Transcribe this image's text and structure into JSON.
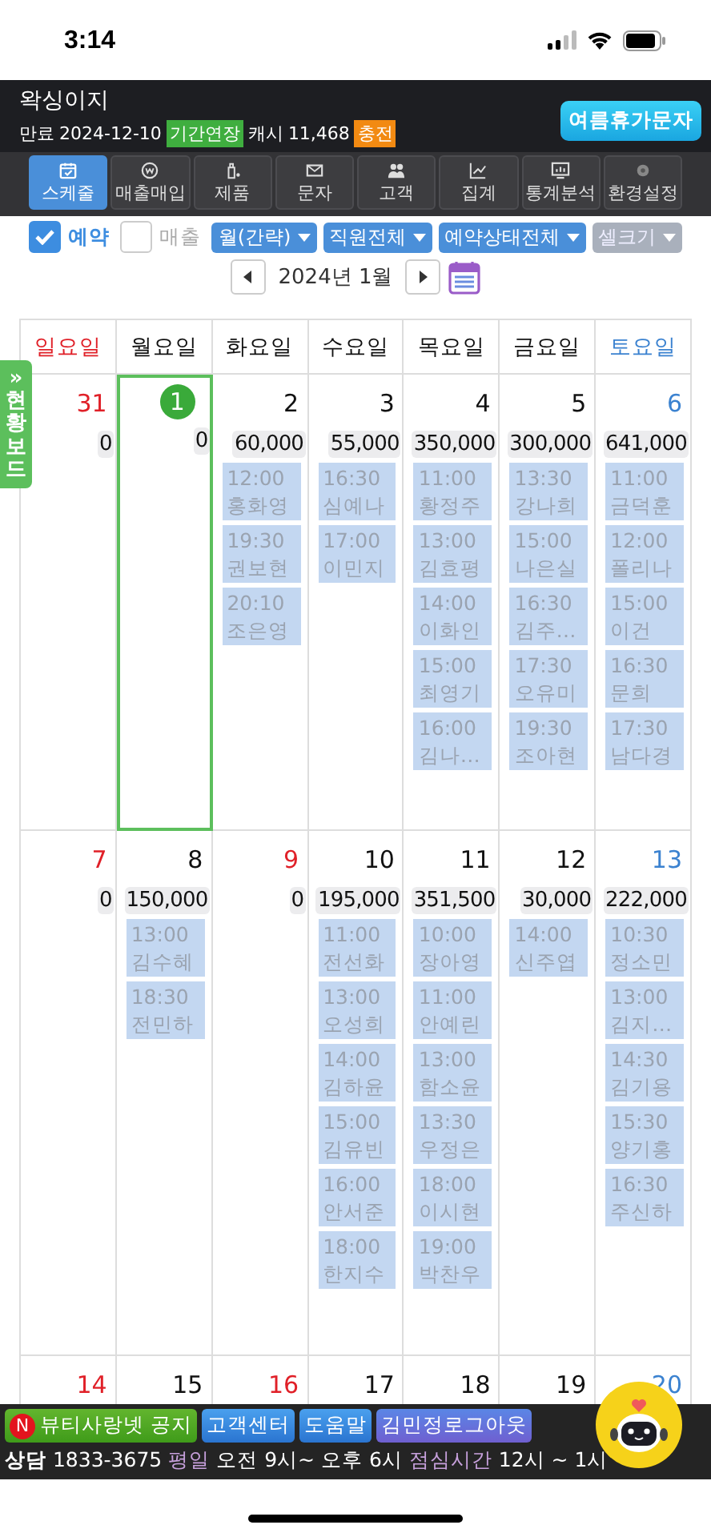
{
  "status_bar": {
    "time": "3:14"
  },
  "header": {
    "title": "왁싱이지",
    "expiry_label": "만료",
    "expiry_date": "2024-12-10",
    "extend_button": "기간연장",
    "cash_label": "캐시",
    "cash_amount": "11,468",
    "charge_button": "충전",
    "promo_button": "여름휴가문자"
  },
  "nav_tabs": [
    {
      "label": "스케줄",
      "selected": true
    },
    {
      "label": "매출매입",
      "selected": false
    },
    {
      "label": "제품",
      "selected": false
    },
    {
      "label": "문자",
      "selected": false
    },
    {
      "label": "고객",
      "selected": false
    },
    {
      "label": "집계",
      "selected": false
    },
    {
      "label": "통계분석",
      "selected": false
    },
    {
      "label": "환경설정",
      "selected": false
    }
  ],
  "filters": {
    "checkboxes": [
      {
        "label": "예약",
        "checked": true
      },
      {
        "label": "매출",
        "checked": false
      }
    ],
    "dropdowns": [
      {
        "label": "월(간략)",
        "disabled": false
      },
      {
        "label": "직원전체",
        "disabled": false
      },
      {
        "label": "예약상태전체",
        "disabled": false
      },
      {
        "label": "셀크기",
        "disabled": true
      }
    ]
  },
  "month_nav": {
    "label": "2024년 1월"
  },
  "side_tab": {
    "arrow": "»",
    "label": "현황보드"
  },
  "calendar": {
    "weekdays": [
      {
        "label": "일요일",
        "kind": "sunday"
      },
      {
        "label": "월요일",
        "kind": "weekday"
      },
      {
        "label": "화요일",
        "kind": "weekday"
      },
      {
        "label": "수요일",
        "kind": "weekday"
      },
      {
        "label": "목요일",
        "kind": "weekday"
      },
      {
        "label": "금요일",
        "kind": "weekday"
      },
      {
        "label": "토요일",
        "kind": "saturday"
      }
    ],
    "weeks": [
      {
        "days": [
          {
            "day": "31",
            "kind": "sunday",
            "today": false,
            "total": "0"
          },
          {
            "day": "1",
            "kind": "weekday",
            "today": true,
            "total": "0"
          },
          {
            "day": "2",
            "kind": "weekday",
            "today": false,
            "total": "60,000",
            "appointments": [
              {
                "time": "12:00",
                "name": "홍화영"
              },
              {
                "time": "19:30",
                "name": "권보현"
              },
              {
                "time": "20:10",
                "name": "조은영"
              }
            ]
          },
          {
            "day": "3",
            "kind": "weekday",
            "today": false,
            "total": "55,000",
            "appointments": [
              {
                "time": "16:30",
                "name": "심예나"
              },
              {
                "time": "17:00",
                "name": "이민지"
              }
            ]
          },
          {
            "day": "4",
            "kind": "weekday",
            "today": false,
            "total": "350,000",
            "appointments": [
              {
                "time": "11:00",
                "name": "황정주"
              },
              {
                "time": "13:00",
                "name": "김효평"
              },
              {
                "time": "14:00",
                "name": "이화인"
              },
              {
                "time": "15:00",
                "name": "최영기"
              },
              {
                "time": "16:00",
                "name": "김나…"
              }
            ]
          },
          {
            "day": "5",
            "kind": "weekday",
            "today": false,
            "total": "300,000",
            "appointments": [
              {
                "time": "13:30",
                "name": "강나희"
              },
              {
                "time": "15:00",
                "name": "나은실"
              },
              {
                "time": "16:30",
                "name": "김주…"
              },
              {
                "time": "17:30",
                "name": "오유미"
              },
              {
                "time": "19:30",
                "name": "조아현"
              }
            ]
          },
          {
            "day": "6",
            "kind": "saturday",
            "today": false,
            "total": "641,000",
            "appointments": [
              {
                "time": "11:00",
                "name": "금덕훈"
              },
              {
                "time": "12:00",
                "name": "폴리나"
              },
              {
                "time": "15:00",
                "name": "이건"
              },
              {
                "time": "16:30",
                "name": "문희"
              },
              {
                "time": "17:30",
                "name": "남다경"
              }
            ]
          }
        ]
      },
      {
        "days": [
          {
            "day": "7",
            "kind": "sunday",
            "today": false,
            "total": "0"
          },
          {
            "day": "8",
            "kind": "weekday",
            "today": false,
            "total": "150,000",
            "appointments": [
              {
                "time": "13:00",
                "name": "김수혜"
              },
              {
                "time": "18:30",
                "name": "전민하"
              }
            ]
          },
          {
            "day": "9",
            "kind": "holiday",
            "today": false,
            "total": "0"
          },
          {
            "day": "10",
            "kind": "weekday",
            "today": false,
            "total": "195,000",
            "appointments": [
              {
                "time": "11:00",
                "name": "전선화"
              },
              {
                "time": "13:00",
                "name": "오성희"
              },
              {
                "time": "14:00",
                "name": "김하윤"
              },
              {
                "time": "15:00",
                "name": "김유빈"
              },
              {
                "time": "16:00",
                "name": "안서준"
              },
              {
                "time": "18:00",
                "name": "한지수"
              }
            ]
          },
          {
            "day": "11",
            "kind": "weekday",
            "today": false,
            "total": "351,500",
            "appointments": [
              {
                "time": "10:00",
                "name": "장아영"
              },
              {
                "time": "11:00",
                "name": "안예린"
              },
              {
                "time": "13:00",
                "name": "함소윤"
              },
              {
                "time": "13:30",
                "name": "우정은"
              },
              {
                "time": "18:00",
                "name": "이시현"
              },
              {
                "time": "19:00",
                "name": "박찬우"
              }
            ]
          },
          {
            "day": "12",
            "kind": "weekday",
            "today": false,
            "total": "30,000",
            "appointments": [
              {
                "time": "14:00",
                "name": "신주엽"
              }
            ]
          },
          {
            "day": "13",
            "kind": "saturday",
            "today": false,
            "total": "222,000",
            "appointments": [
              {
                "time": "10:30",
                "name": "정소민"
              },
              {
                "time": "13:00",
                "name": "김지…"
              },
              {
                "time": "14:30",
                "name": "김기용"
              },
              {
                "time": "15:30",
                "name": "양기홍"
              },
              {
                "time": "16:30",
                "name": "주신하"
              }
            ]
          }
        ]
      },
      {
        "days": [
          {
            "day": "14",
            "kind": "sunday",
            "today": false
          },
          {
            "day": "15",
            "kind": "weekday",
            "today": false
          },
          {
            "day": "16",
            "kind": "holiday",
            "today": false
          },
          {
            "day": "17",
            "kind": "weekday",
            "today": false
          },
          {
            "day": "18",
            "kind": "weekday",
            "today": false
          },
          {
            "day": "19",
            "kind": "weekday",
            "today": false
          },
          {
            "day": "20",
            "kind": "saturday",
            "today": false
          }
        ]
      }
    ]
  },
  "footer": {
    "links": [
      {
        "label": "뷰티사랑넷 공지",
        "badge": "N",
        "kind": "notice"
      },
      {
        "label": "고객센터",
        "kind": "help"
      },
      {
        "label": "도움말",
        "kind": "help"
      },
      {
        "label": "김민정로그아웃",
        "kind": "account"
      }
    ],
    "contact": [
      {
        "text": "상담",
        "kind": "strong"
      },
      {
        "text": "1833-3675",
        "kind": "plain"
      },
      {
        "text": "평일",
        "kind": "accent"
      },
      {
        "text": "오전 9시~ 오후 6시",
        "kind": "plain"
      },
      {
        "text": "점심시간",
        "kind": "accent"
      },
      {
        "text": "12시 ~ 1시",
        "kind": "plain"
      }
    ]
  }
}
